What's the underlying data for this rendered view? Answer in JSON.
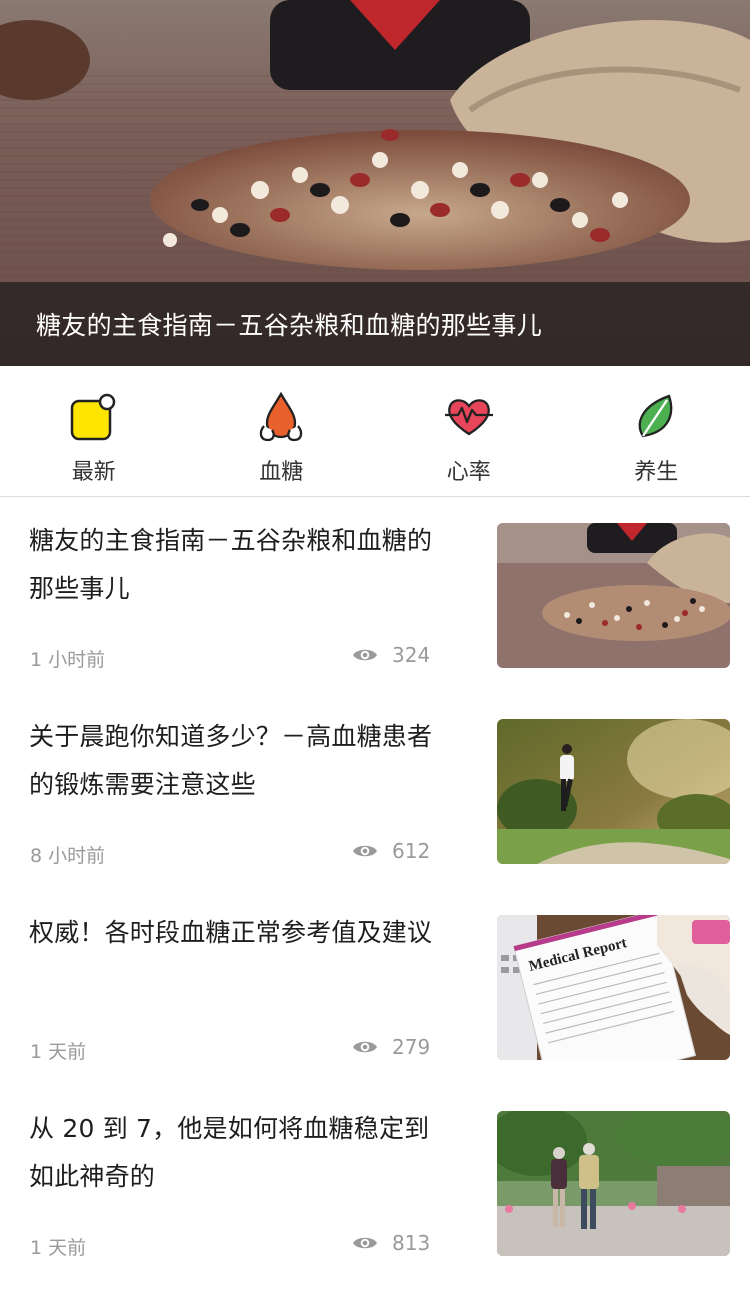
{
  "hero": {
    "title": "糖友的主食指南－五谷杂粮和血糖的那些事儿"
  },
  "categories": [
    {
      "label": "最新",
      "icon": "new-badge-icon"
    },
    {
      "label": "血糖",
      "icon": "blood-drop-icon"
    },
    {
      "label": "心率",
      "icon": "heart-rate-icon"
    },
    {
      "label": "养生",
      "icon": "leaf-icon"
    }
  ],
  "articles": [
    {
      "title": "糖友的主食指南－五谷杂粮和血糖的那些事儿",
      "time": "1 小时前",
      "views": "324",
      "thumb": "grains-photo"
    },
    {
      "title": "关于晨跑你知道多少？－高血糖患者的锻炼需要注意这些",
      "time": "8 小时前",
      "views": "612",
      "thumb": "runner-photo"
    },
    {
      "title": "权威！各时段血糖正常参考值及建议",
      "time": "1 天前",
      "views": "279",
      "thumb": "medical-report-photo",
      "thumb_text": "Medical Report"
    },
    {
      "title": "从 20 到 7，他是如何将血糖稳定到如此神奇的",
      "time": "1 天前",
      "views": "813",
      "thumb": "elderly-couple-photo"
    }
  ],
  "colors": {
    "new_icon": "#ffe600",
    "blood_icon": "#e8602c",
    "heart_icon": "#e8455a",
    "leaf_icon": "#4caf50"
  }
}
